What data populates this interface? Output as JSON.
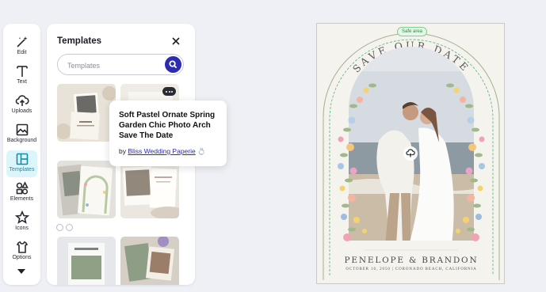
{
  "rail": {
    "items": [
      {
        "label": "Edit",
        "icon": "magic-wand-icon"
      },
      {
        "label": "Text",
        "icon": "text-icon"
      },
      {
        "label": "Uploads",
        "icon": "cloud-upload-icon"
      },
      {
        "label": "Background",
        "icon": "image-icon"
      },
      {
        "label": "Templates",
        "icon": "templates-icon",
        "active": true
      },
      {
        "label": "Elements",
        "icon": "shapes-icon"
      },
      {
        "label": "Icons",
        "icon": "star-icon"
      },
      {
        "label": "Options",
        "icon": "apron-icon"
      }
    ]
  },
  "panel": {
    "title": "Templates",
    "search_placeholder": "Templates"
  },
  "tooltip": {
    "title": "Soft Pastel Ornate Spring Garden Chic Photo Arch Save The Date",
    "by": "by",
    "author": "Bliss Wedding Paperie",
    "author_emoji": "💍"
  },
  "canvas": {
    "safe_area": "Safe area",
    "headline": "SAVE OUR DATE",
    "names": "PENELOPE & BRANDON",
    "details": "OCTOBER 16, 2050 | CORONADO BEACH, CALIFORNIA"
  },
  "colors": {
    "accent": "#2c2bb3",
    "active_tab_bg": "#dcf5fb",
    "active_tab_fg": "#148cab",
    "safe_area_green": "#2e8a43"
  }
}
